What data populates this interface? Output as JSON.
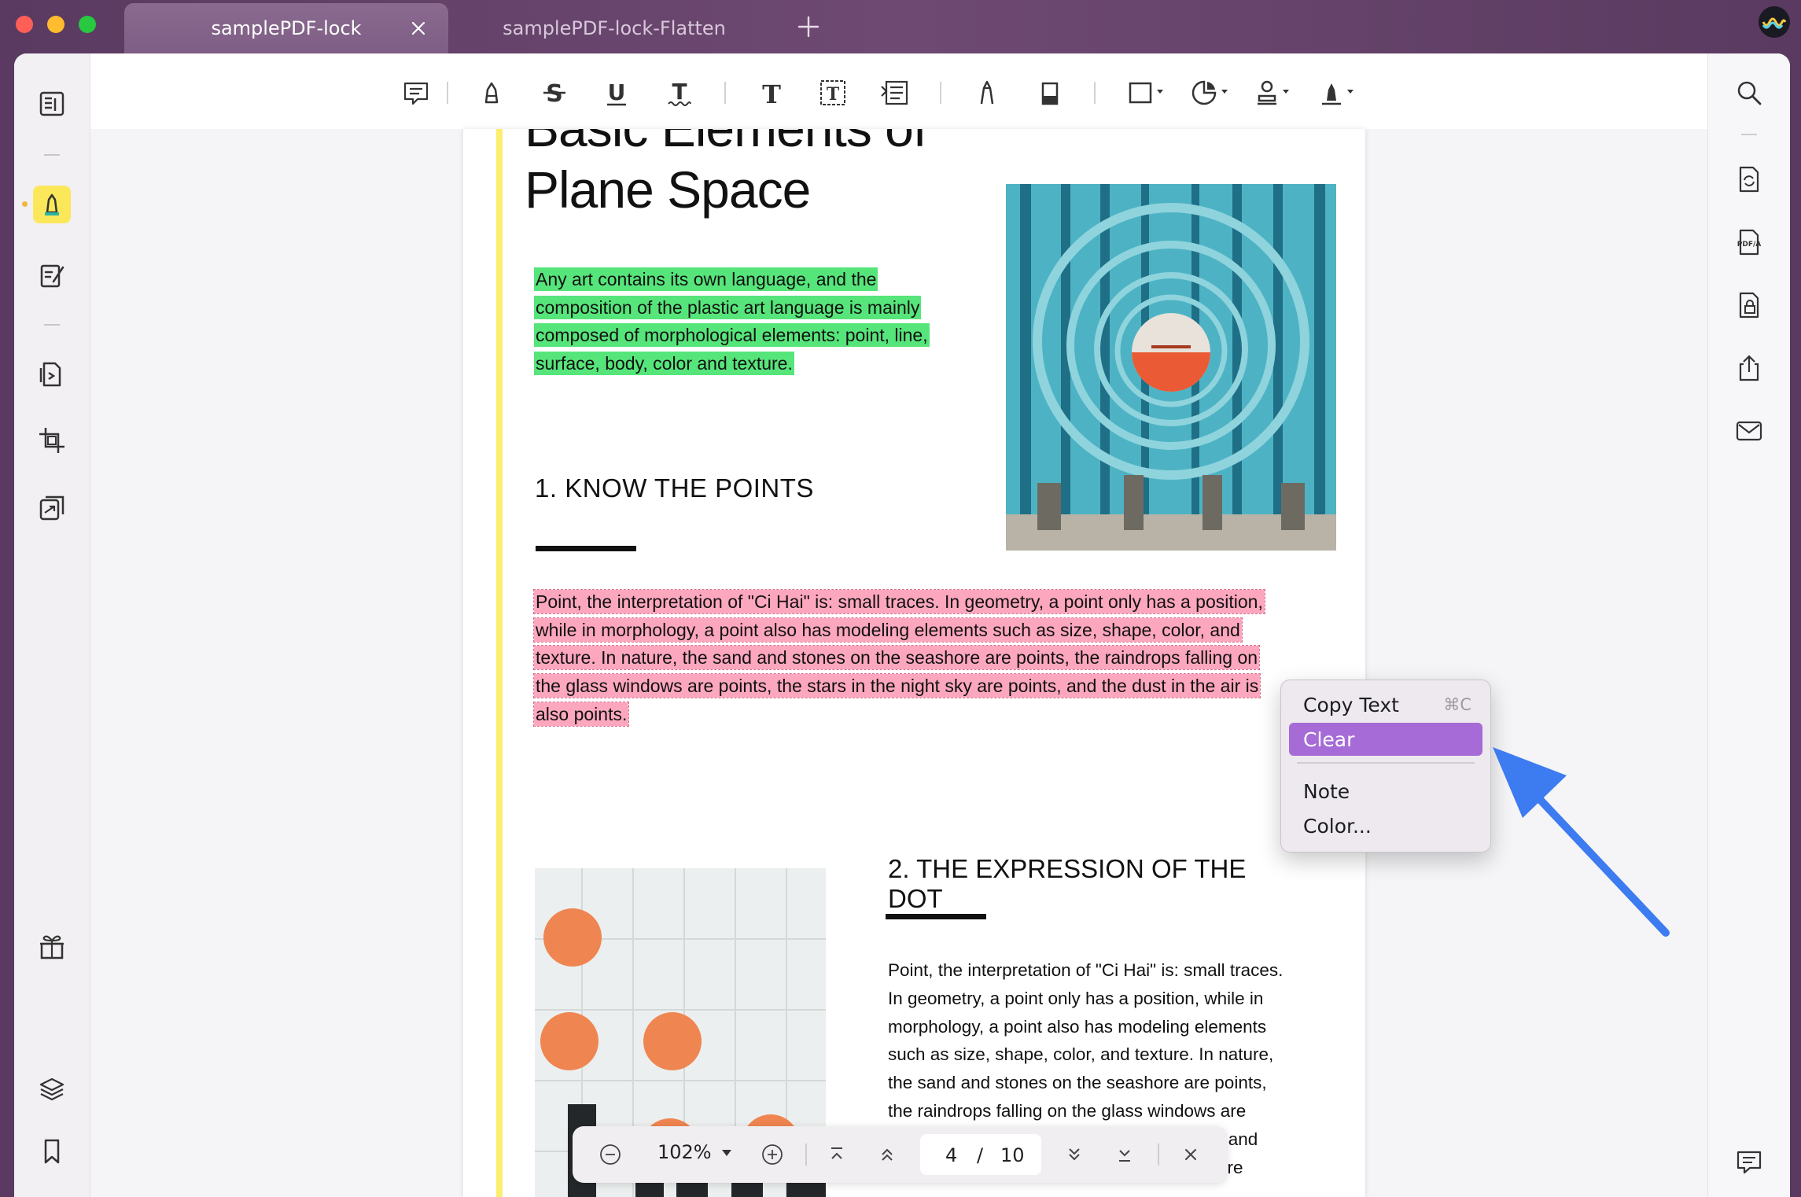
{
  "tabs": [
    {
      "label": "samplePDF-lock",
      "active": true
    },
    {
      "label": "samplePDF-lock-Flatten",
      "active": false
    }
  ],
  "document": {
    "title_line1": "Basic Elements of",
    "title_line2": "Plane Space",
    "intro_lines": [
      "Any art contains its own language, and the",
      "composition of the plastic art language is mainly",
      "composed of morphological elements: point, line,",
      "surface, body, color and texture."
    ],
    "section1_heading": "1. KNOW THE POINTS",
    "highlighted_lines": [
      "Point, the interpretation of \"Ci Hai\" is: small traces. In geometry, a point only has a position,",
      "while in morphology, a point also has modeling elements such as size, shape, color, and",
      "texture. In nature, the sand and stones on the seashore are points, the raindrops falling on",
      "the glass windows are points, the stars in the night sky are points, and the dust in the air is",
      "also points."
    ],
    "section2_heading_line1": "2. THE  EXPRESSION    OF  THE",
    "section2_heading_line2": "DOT",
    "section2_lines": [
      "Point, the interpretation of \"Ci Hai\" is: small traces.",
      "In geometry, a point only has a position, while in",
      "morphology, a point also has modeling elements",
      "such as size, shape, color, and texture. In nature,",
      "the sand and stones on the seashore are points,",
      "the raindrops falling on the glass windows are",
      "points, the stars in the night sky are points, and",
      "the dust in the air is also points. In the picture"
    ]
  },
  "context_menu": {
    "copy_text": "Copy Text",
    "copy_shortcut": "⌘C",
    "clear": "Clear",
    "note": "Note",
    "color": "Color..."
  },
  "bottom_bar": {
    "zoom": "102%",
    "current_page": "4",
    "separator": "/",
    "total_pages": "10"
  },
  "colors": {
    "highlight_green": "#56e57a",
    "highlight_pink": "#fda7bf",
    "menu_selected": "#a66bd6",
    "annotation_arrow": "#3d7bf0",
    "active_tool": "#fbe85a"
  },
  "icons": {
    "left_sidebar": [
      "reader-icon",
      "highlighter-icon",
      "edit-pdf-icon",
      "organize-pages-icon",
      "crop-icon",
      "compare-icon",
      "gift-icon",
      "layers-icon",
      "bookmark-icon"
    ],
    "toolbar": [
      "comment-icon",
      "highlight-icon",
      "strikethrough-icon",
      "underline-icon",
      "squiggly-underline-icon",
      "text-icon",
      "textbox-icon",
      "text-callout-icon",
      "pencil-icon",
      "eraser-icon",
      "shape-icon",
      "sticker-icon",
      "stamp-icon",
      "signature-icon"
    ],
    "right_sidebar": [
      "search-icon",
      "convert-icon",
      "pdfa-icon",
      "protect-icon",
      "share-icon",
      "email-icon",
      "comments-icon"
    ]
  }
}
